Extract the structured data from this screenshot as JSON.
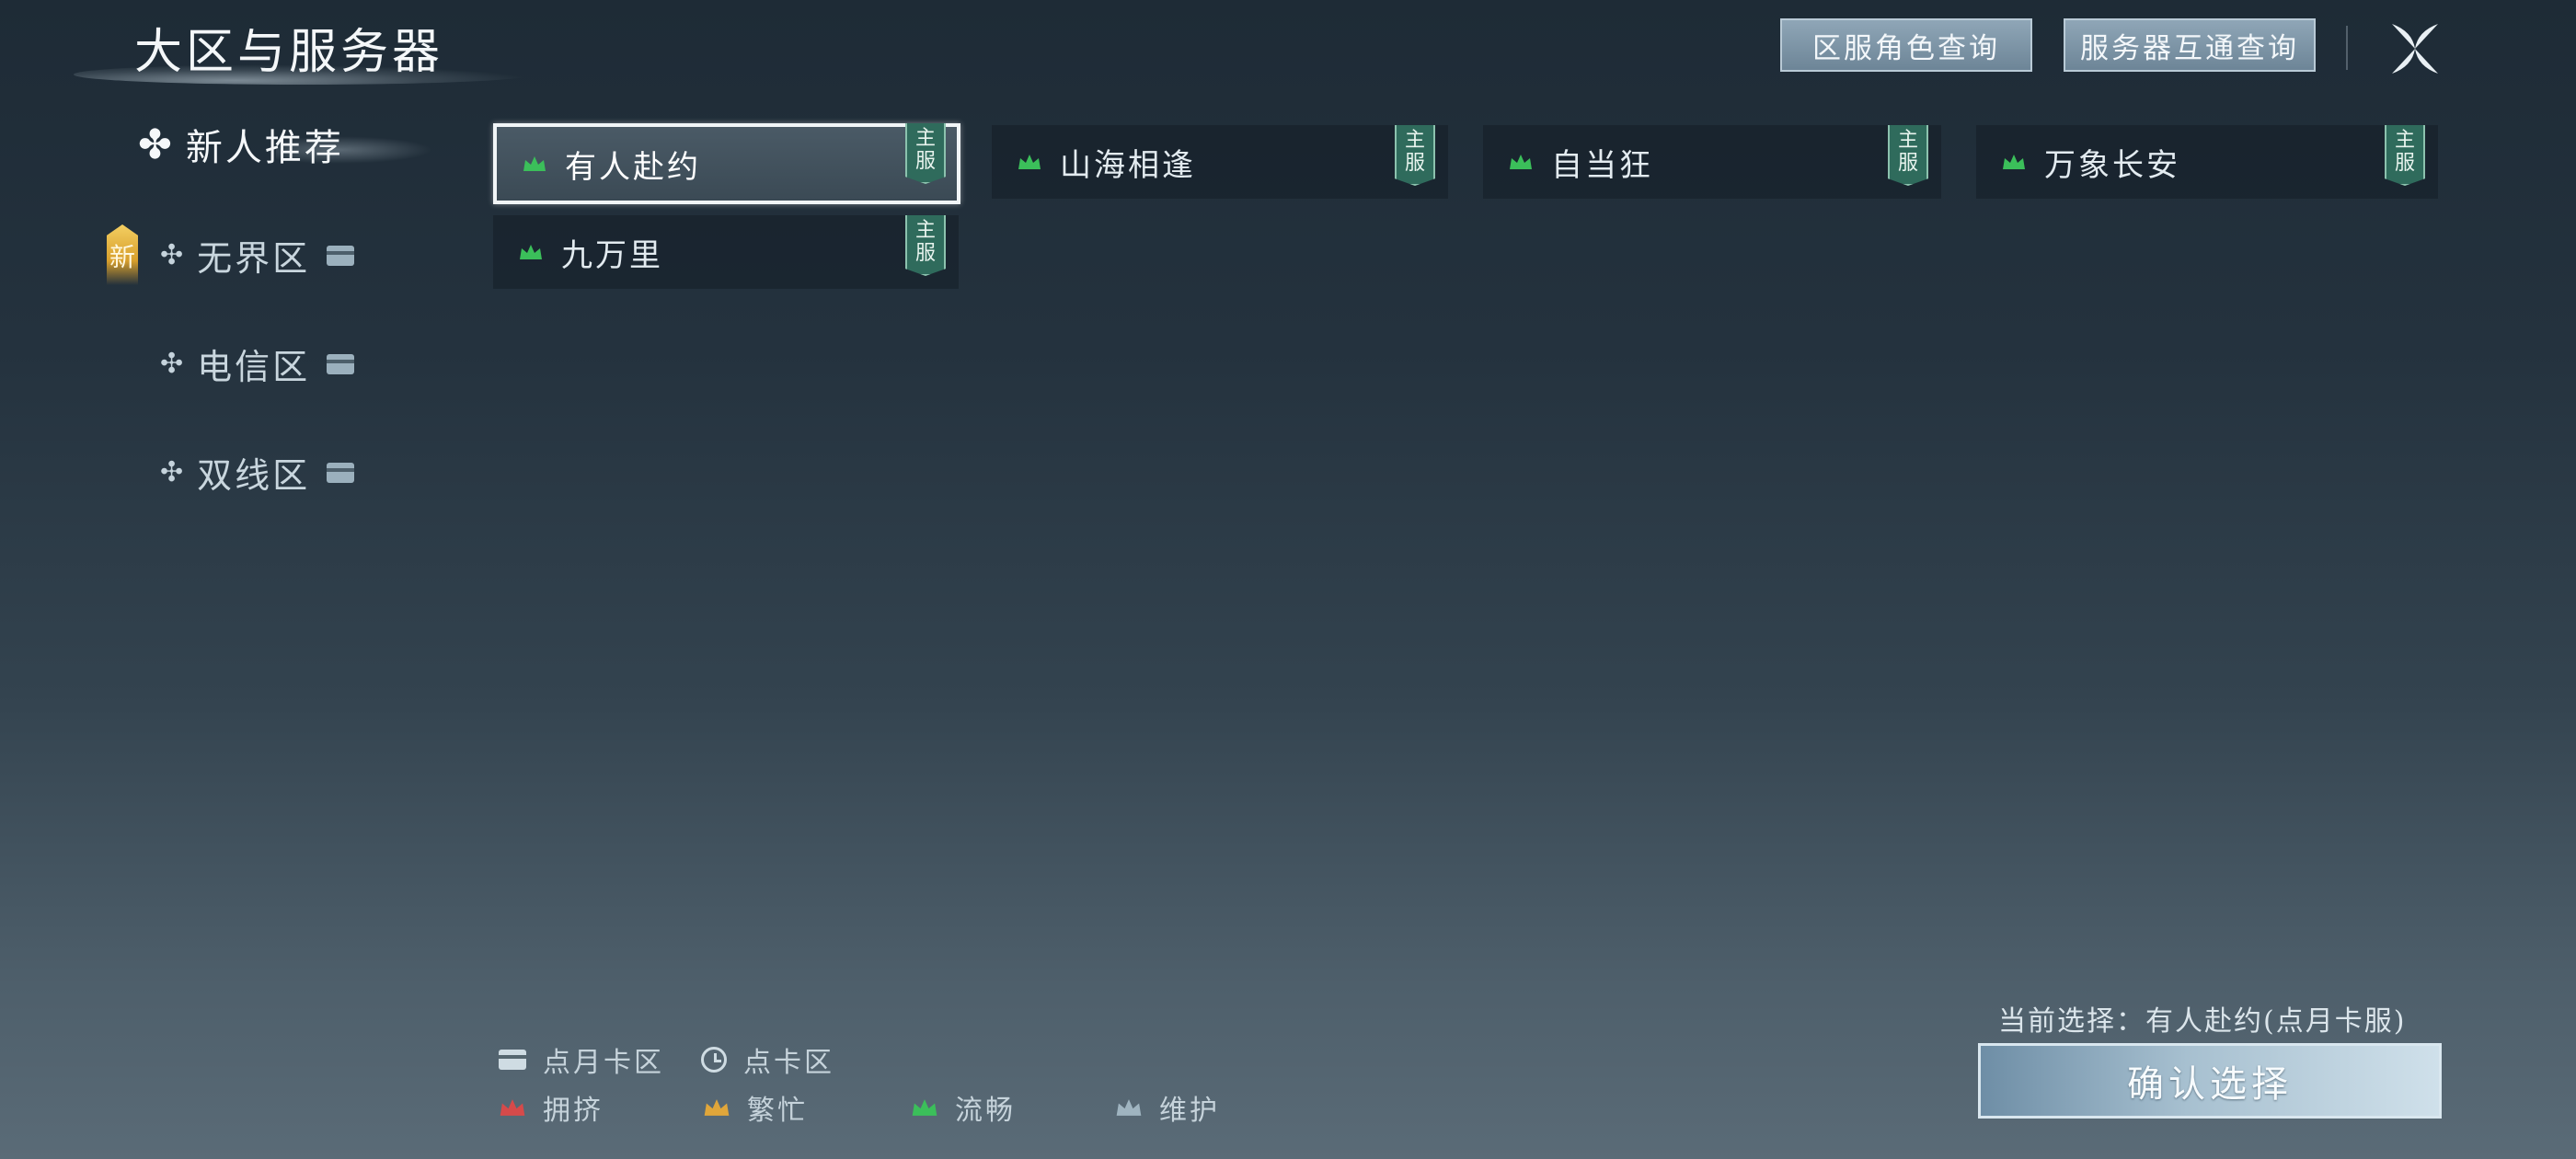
{
  "header": {
    "title": "大区与服务器",
    "buttons": {
      "role_query": "区服角色查询",
      "server_interop": "服务器互通查询"
    },
    "close_icon": "close-icon"
  },
  "sidebar": {
    "items": [
      {
        "label": "新人推荐",
        "active": true,
        "icon": "flower-icon"
      },
      {
        "label": "无界区",
        "badge": "新",
        "card_icon": true
      },
      {
        "label": "电信区",
        "card_icon": true
      },
      {
        "label": "双线区",
        "card_icon": true
      }
    ]
  },
  "servers": [
    {
      "name": "有人赴约",
      "tag": "主服",
      "status": "流畅",
      "selected": true
    },
    {
      "name": "山海相逢",
      "tag": "主服",
      "status": "流畅"
    },
    {
      "name": "自当狂",
      "tag": "主服",
      "status": "流畅"
    },
    {
      "name": "万象长安",
      "tag": "主服",
      "status": "流畅"
    },
    {
      "name": "九万里",
      "tag": "主服",
      "status": "流畅"
    }
  ],
  "legend": {
    "monthly_card": "点月卡区",
    "point_card": "点卡区",
    "crowded": "拥挤",
    "busy": "繁忙",
    "smooth": "流畅",
    "maintenance": "维护"
  },
  "colors": {
    "crowded": "#d64a4a",
    "busy": "#e0a63a",
    "smooth": "#3bbf5a",
    "maintenance": "#9fb4c0",
    "main_tag": "#2f6b5c"
  },
  "footer": {
    "current_selection": "当前选择：有人赴约(点月卡服)",
    "confirm": "确认选择"
  }
}
